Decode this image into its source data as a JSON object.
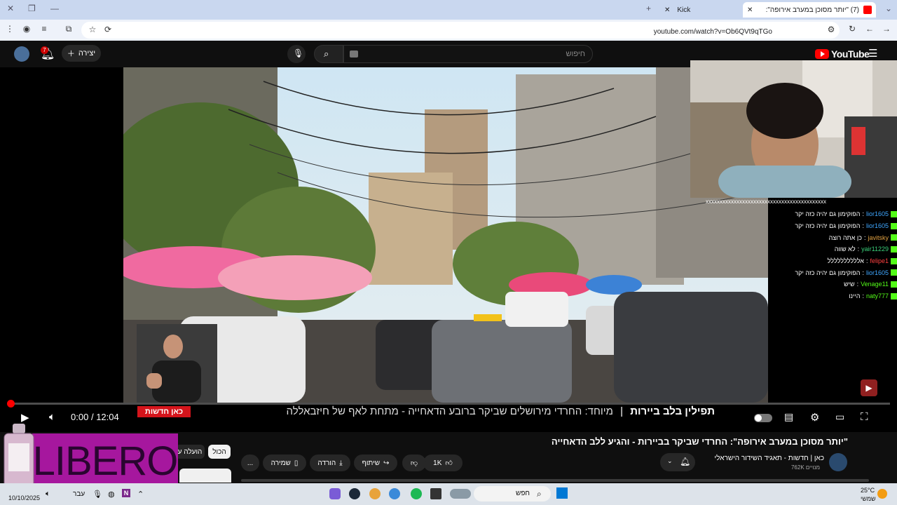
{
  "browser": {
    "active_tab_title": "(7) \"יותר מסוכן במערב אירופה\":",
    "inactive_tab_title": "Kick",
    "url": "youtube.com/watch?v=Ob6QVt9qTGo"
  },
  "youtube": {
    "logo_text": "YouTube",
    "search_placeholder": "חיפוש",
    "create_label": "יצירה",
    "notification_count": "7"
  },
  "player": {
    "current_time": "0:00",
    "duration": "12:04",
    "time_separator": "/",
    "progress_fraction": 0.0,
    "news_tag": "כאן חדשות",
    "ticker_title": "תפילין בלב ביירות",
    "ticker_text": "מיוחד: החרדי מירושלים שביקר ברובע הדאחייה - מתחת לאף של חיזבאללה"
  },
  "chat": {
    "banner": "xxxxxxxxxxxxxxxxxxxxxxxxxxxxxxxxxxxxxxxxxxx",
    "messages": [
      {
        "user": "lior1605",
        "text": "הפוקימון גם יהיה כזה יקר",
        "color": "#3fa7ff"
      },
      {
        "user": "lior1605",
        "text": "הפוקימון גם יהיה כזה יקר",
        "color": "#3fa7ff"
      },
      {
        "user": "javitsky",
        "text": "כן אתה רוצה",
        "color": "#e0a040"
      },
      {
        "user": "yair11229",
        "text": "לא שווה",
        "color": "#3ad17a"
      },
      {
        "user": "felipe1",
        "text": "אלללללללללל",
        "color": "#ff4040"
      },
      {
        "user": "lior1605",
        "text": "הפוקימון גם יהיה כזה יקר",
        "color": "#3fa7ff"
      },
      {
        "user": "Venage11",
        "text": "שיש",
        "color": "#53fc18"
      },
      {
        "user": "naty777",
        "text": "היינו",
        "color": "#53fc18"
      }
    ]
  },
  "video": {
    "title": "\"יותר מסוכן במערב אירופה\": החרדי שביקר בביירות - והגיע ללב הדאחייה",
    "channel": "כאן | חדשות - תאגיד השידור הישראלי",
    "subscribers": "762K מנויים",
    "likes": "1K",
    "share_label": "שיתוף",
    "download_label": "הורדה",
    "save_label": "שמירה",
    "more_label": "...",
    "chip_all": "הכול",
    "chip_uploaded": "הועלה ע"
  },
  "overlay": {
    "libero_text": "LIBERO"
  },
  "taskbar": {
    "search_placeholder": "חפש",
    "weather_temp": "25°C",
    "weather_desc": "שמשי",
    "language": "עבר",
    "date": "10/10/2025"
  }
}
